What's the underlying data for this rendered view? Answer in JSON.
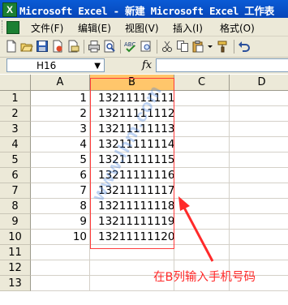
{
  "window": {
    "title": "Microsoft Excel - 新建 Microsoft Excel 工作表",
    "app_icon_glyph": "X"
  },
  "menubar": {
    "items": [
      "文件(F)",
      "编辑(E)",
      "视图(V)",
      "插入(I)",
      "格式(O)"
    ]
  },
  "toolbar": {
    "buttons": [
      "new-icon",
      "open-icon",
      "save-icon",
      "permission-icon",
      "email-icon",
      "print-icon",
      "print-preview-icon",
      "spelling-icon",
      "cut-icon",
      "copy-icon",
      "paste-icon",
      "format-painter-icon"
    ]
  },
  "formula_bar": {
    "name_box": "H16",
    "fx": "fx",
    "formula": ""
  },
  "grid": {
    "columns": [
      "A",
      "B",
      "C",
      "D"
    ],
    "selected_column": "B",
    "rows": [
      "1",
      "2",
      "3",
      "4",
      "5",
      "6",
      "7",
      "8",
      "9",
      "10",
      "11",
      "12",
      "13"
    ],
    "data": [
      [
        "1",
        "13211111111"
      ],
      [
        "2",
        "13211111112"
      ],
      [
        "3",
        "13211111113"
      ],
      [
        "4",
        "13211111114"
      ],
      [
        "5",
        "13211111115"
      ],
      [
        "6",
        "13211111116"
      ],
      [
        "7",
        "13211111117"
      ],
      [
        "8",
        "13211111118"
      ],
      [
        "9",
        "13211111119"
      ],
      [
        "10",
        "13211111120"
      ]
    ]
  },
  "annotation": {
    "text": "在B列输入手机号码",
    "color": "#ff2a2a"
  },
  "watermark": {
    "text": "www.lhm.com"
  }
}
